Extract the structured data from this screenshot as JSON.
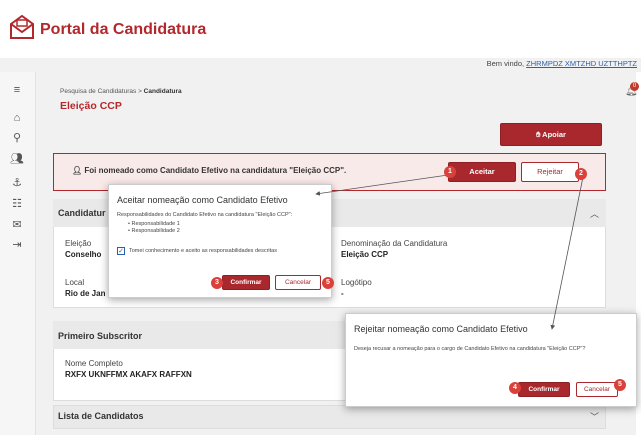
{
  "app": {
    "title": "Portal da Candidatura"
  },
  "header": {
    "welcome_prefix": "Bem vindo, ",
    "user_link": "ZHRMPDZ XMTZHD UZTTHPTZ"
  },
  "sidebar": {
    "icons": [
      "menu-icon",
      "home-icon",
      "search-icon",
      "users-icon",
      "anchor-icon",
      "people-icon",
      "megaphone-icon",
      "logout-icon"
    ]
  },
  "notifications": {
    "badge": "0"
  },
  "breadcrumb": {
    "item1": "Pesquisa de Candidaturas",
    "sep": ">",
    "item2": "Candidatura"
  },
  "page": {
    "title": "Eleição CCP"
  },
  "actions": {
    "support_label": "Apoiar"
  },
  "notice": {
    "text": "Foi nomeado como Candidato Efetivo na candidatura \"Eleição CCP\".",
    "accept_label": "Aceitar",
    "reject_label": "Rejeitar"
  },
  "candidatura_card": {
    "title": "Candidatur",
    "eleicao_label": "Eleição",
    "eleicao_value": "Conselho",
    "local_label": "Local",
    "local_value": "Rio de Jan",
    "denominacao_label": "Denominação da Candidatura",
    "denominacao_value": "Eleição CCP",
    "logotipo_label": "Logótipo",
    "logotipo_value": "-"
  },
  "subscritor_card": {
    "title": "Primeiro Subscritor",
    "nome_label": "Nome Completo",
    "nome_value": "RXFX UKNFFMX AKAFX RAFFXN"
  },
  "candidatos_card": {
    "title": "Lista de Candidatos"
  },
  "accept_dialog": {
    "title": "Aceitar nomeação como Candidato Efetivo",
    "description": "Responsabilidades do Candidato Efetivo na candidatura \"Eleição CCP\":",
    "responsibilities": [
      "Responsabilidade 1",
      "Responsabilidade 2"
    ],
    "checkbox_label": "Tomei conhecimento e aceito as responsabilidades descritas",
    "confirm_label": "Confirmar",
    "cancel_label": "Cancelar"
  },
  "reject_dialog": {
    "title": "Rejeitar nomeação como Candidato Efetivo",
    "description": "Deseja recusar a nomeação para o cargo de Candidato Efetivo na candidatura \"Eleição CCP\"?",
    "confirm_label": "Confirmar",
    "cancel_label": "Cancelar"
  },
  "markers": [
    "1",
    "2",
    "3",
    "4",
    "5",
    "5"
  ],
  "colors": {
    "brand": "#b3282d",
    "marker": "#d9413a",
    "link": "#2b5fb3"
  }
}
